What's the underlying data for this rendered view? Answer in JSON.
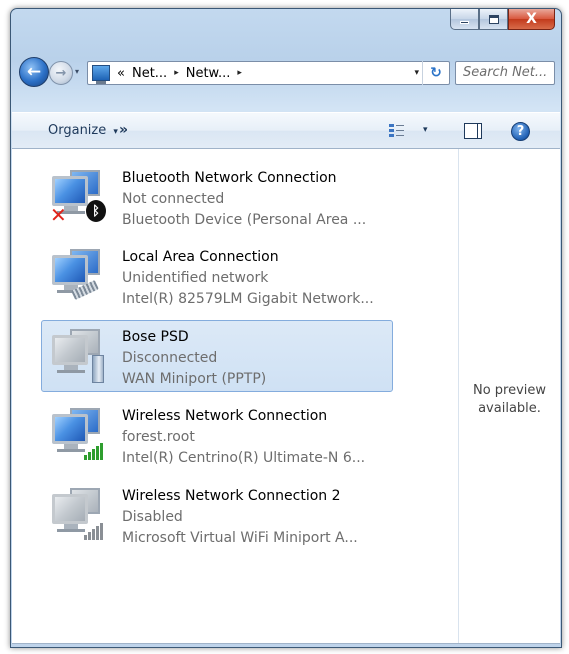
{
  "window": {
    "controls": {
      "minimize": "—",
      "maximize": "□",
      "close": "X"
    }
  },
  "navigation": {
    "back_icon": "back-arrow-icon",
    "forward_icon": "forward-arrow-icon",
    "back_glyph": "←",
    "forward_glyph": "→",
    "recent_glyph": "▾",
    "breadcrumb_prefix": "«",
    "breadcrumbs": [
      "Net...",
      "Netw..."
    ],
    "breadcrumb_sep": "▸",
    "dropdown_glyph": "▾",
    "refresh_glyph": "↻",
    "search_placeholder": "Search Net..."
  },
  "command_bar": {
    "organize_label": "Organize",
    "organize_arrow": "▾",
    "more_label": "»",
    "views_arrow": "▾",
    "help_label": "?"
  },
  "connections": [
    {
      "name": "Bluetooth Network Connection",
      "status": "Not connected",
      "device": "Bluetooth Device (Personal Area ...",
      "icon": "bluetooth-network-icon",
      "selected": false
    },
    {
      "name": "Local Area Connection",
      "status": "Unidentified network",
      "device": "Intel(R) 82579LM Gigabit Network...",
      "icon": "ethernet-network-icon",
      "selected": false
    },
    {
      "name": "Bose PSD",
      "status": "Disconnected",
      "device": "WAN Miniport (PPTP)",
      "icon": "vpn-network-icon",
      "selected": true
    },
    {
      "name": "Wireless Network Connection",
      "status": "forest.root",
      "device": "Intel(R) Centrino(R) Ultimate-N 6...",
      "icon": "wireless-network-icon",
      "selected": false
    },
    {
      "name": "Wireless Network Connection 2",
      "status": "Disabled",
      "device": "Microsoft Virtual WiFi Miniport A...",
      "icon": "wireless-disabled-icon",
      "selected": false
    }
  ],
  "badges": {
    "error": "✕",
    "bluetooth": "ᛒ"
  },
  "preview": {
    "line1": "No preview",
    "line2": "available."
  },
  "colors": {
    "selection_bg": "#cfe1f4",
    "selection_border": "#84acdd",
    "status_text": "#6d6d6d",
    "signal_green": "#2f9e2f"
  }
}
